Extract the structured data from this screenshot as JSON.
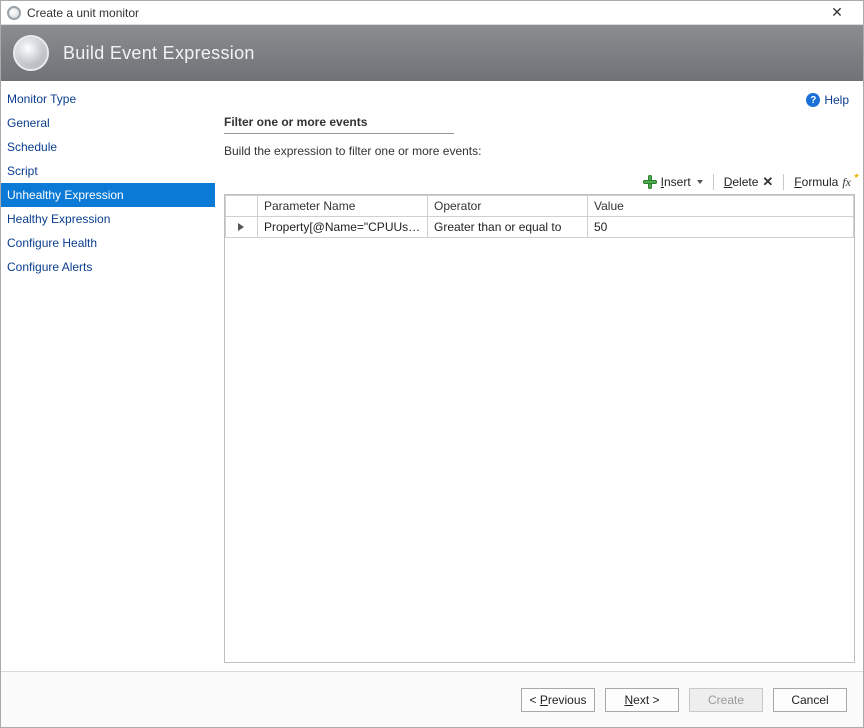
{
  "window": {
    "title": "Create a unit monitor"
  },
  "header": {
    "title": "Build Event Expression"
  },
  "sidebar": {
    "items": [
      {
        "label": "Monitor Type"
      },
      {
        "label": "General"
      },
      {
        "label": "Schedule"
      },
      {
        "label": "Script"
      },
      {
        "label": "Unhealthy Expression"
      },
      {
        "label": "Healthy Expression"
      },
      {
        "label": "Configure Health"
      },
      {
        "label": "Configure Alerts"
      }
    ],
    "active_index": 4
  },
  "help": {
    "label": "Help"
  },
  "section": {
    "title": "Filter one or more events",
    "subtitle": "Build the expression to filter one or more events:"
  },
  "toolbar": {
    "insert": {
      "accel": "I",
      "rest": "nsert"
    },
    "delete": {
      "accel": "D",
      "rest": "elete"
    },
    "formula": {
      "accel": "F",
      "rest": "ormula"
    }
  },
  "grid": {
    "columns": {
      "parameter": "Parameter Name",
      "operator": "Operator",
      "value": "Value"
    },
    "rows": [
      {
        "parameter": "Property[@Name=\"CPUUsage\"]",
        "operator": "Greater than or equal to",
        "value": "50"
      }
    ]
  },
  "footer": {
    "previous": {
      "prefix": "< ",
      "accel": "P",
      "rest": "revious"
    },
    "next": {
      "accel": "N",
      "rest": "ext >"
    },
    "create": {
      "label": "Create"
    },
    "cancel": {
      "label": "Cancel"
    }
  }
}
